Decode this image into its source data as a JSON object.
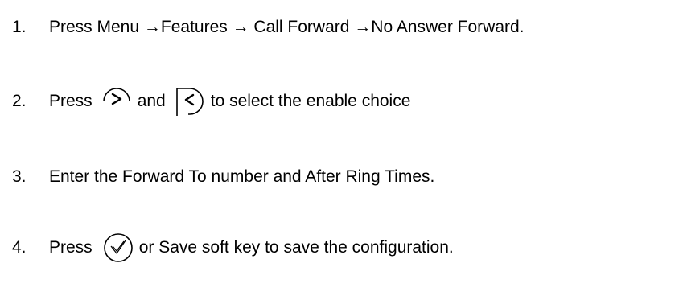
{
  "steps": [
    {
      "number": "1.",
      "text": "Press Menu →Features → Call Forward →No Answer Forward."
    },
    {
      "number": "2.",
      "press": "Press",
      "and": "and",
      "tail": "to select the enable choice",
      "icon_1": "right-arrow-key-icon",
      "icon_2": "left-arrow-key-icon"
    },
    {
      "number": "3.",
      "text": "Enter the Forward To number and After Ring Times."
    },
    {
      "number": "4.",
      "press": "Press",
      "tail": "or Save soft key to save the configuration.",
      "icon_1": "ok-checkmark-key-icon"
    }
  ]
}
